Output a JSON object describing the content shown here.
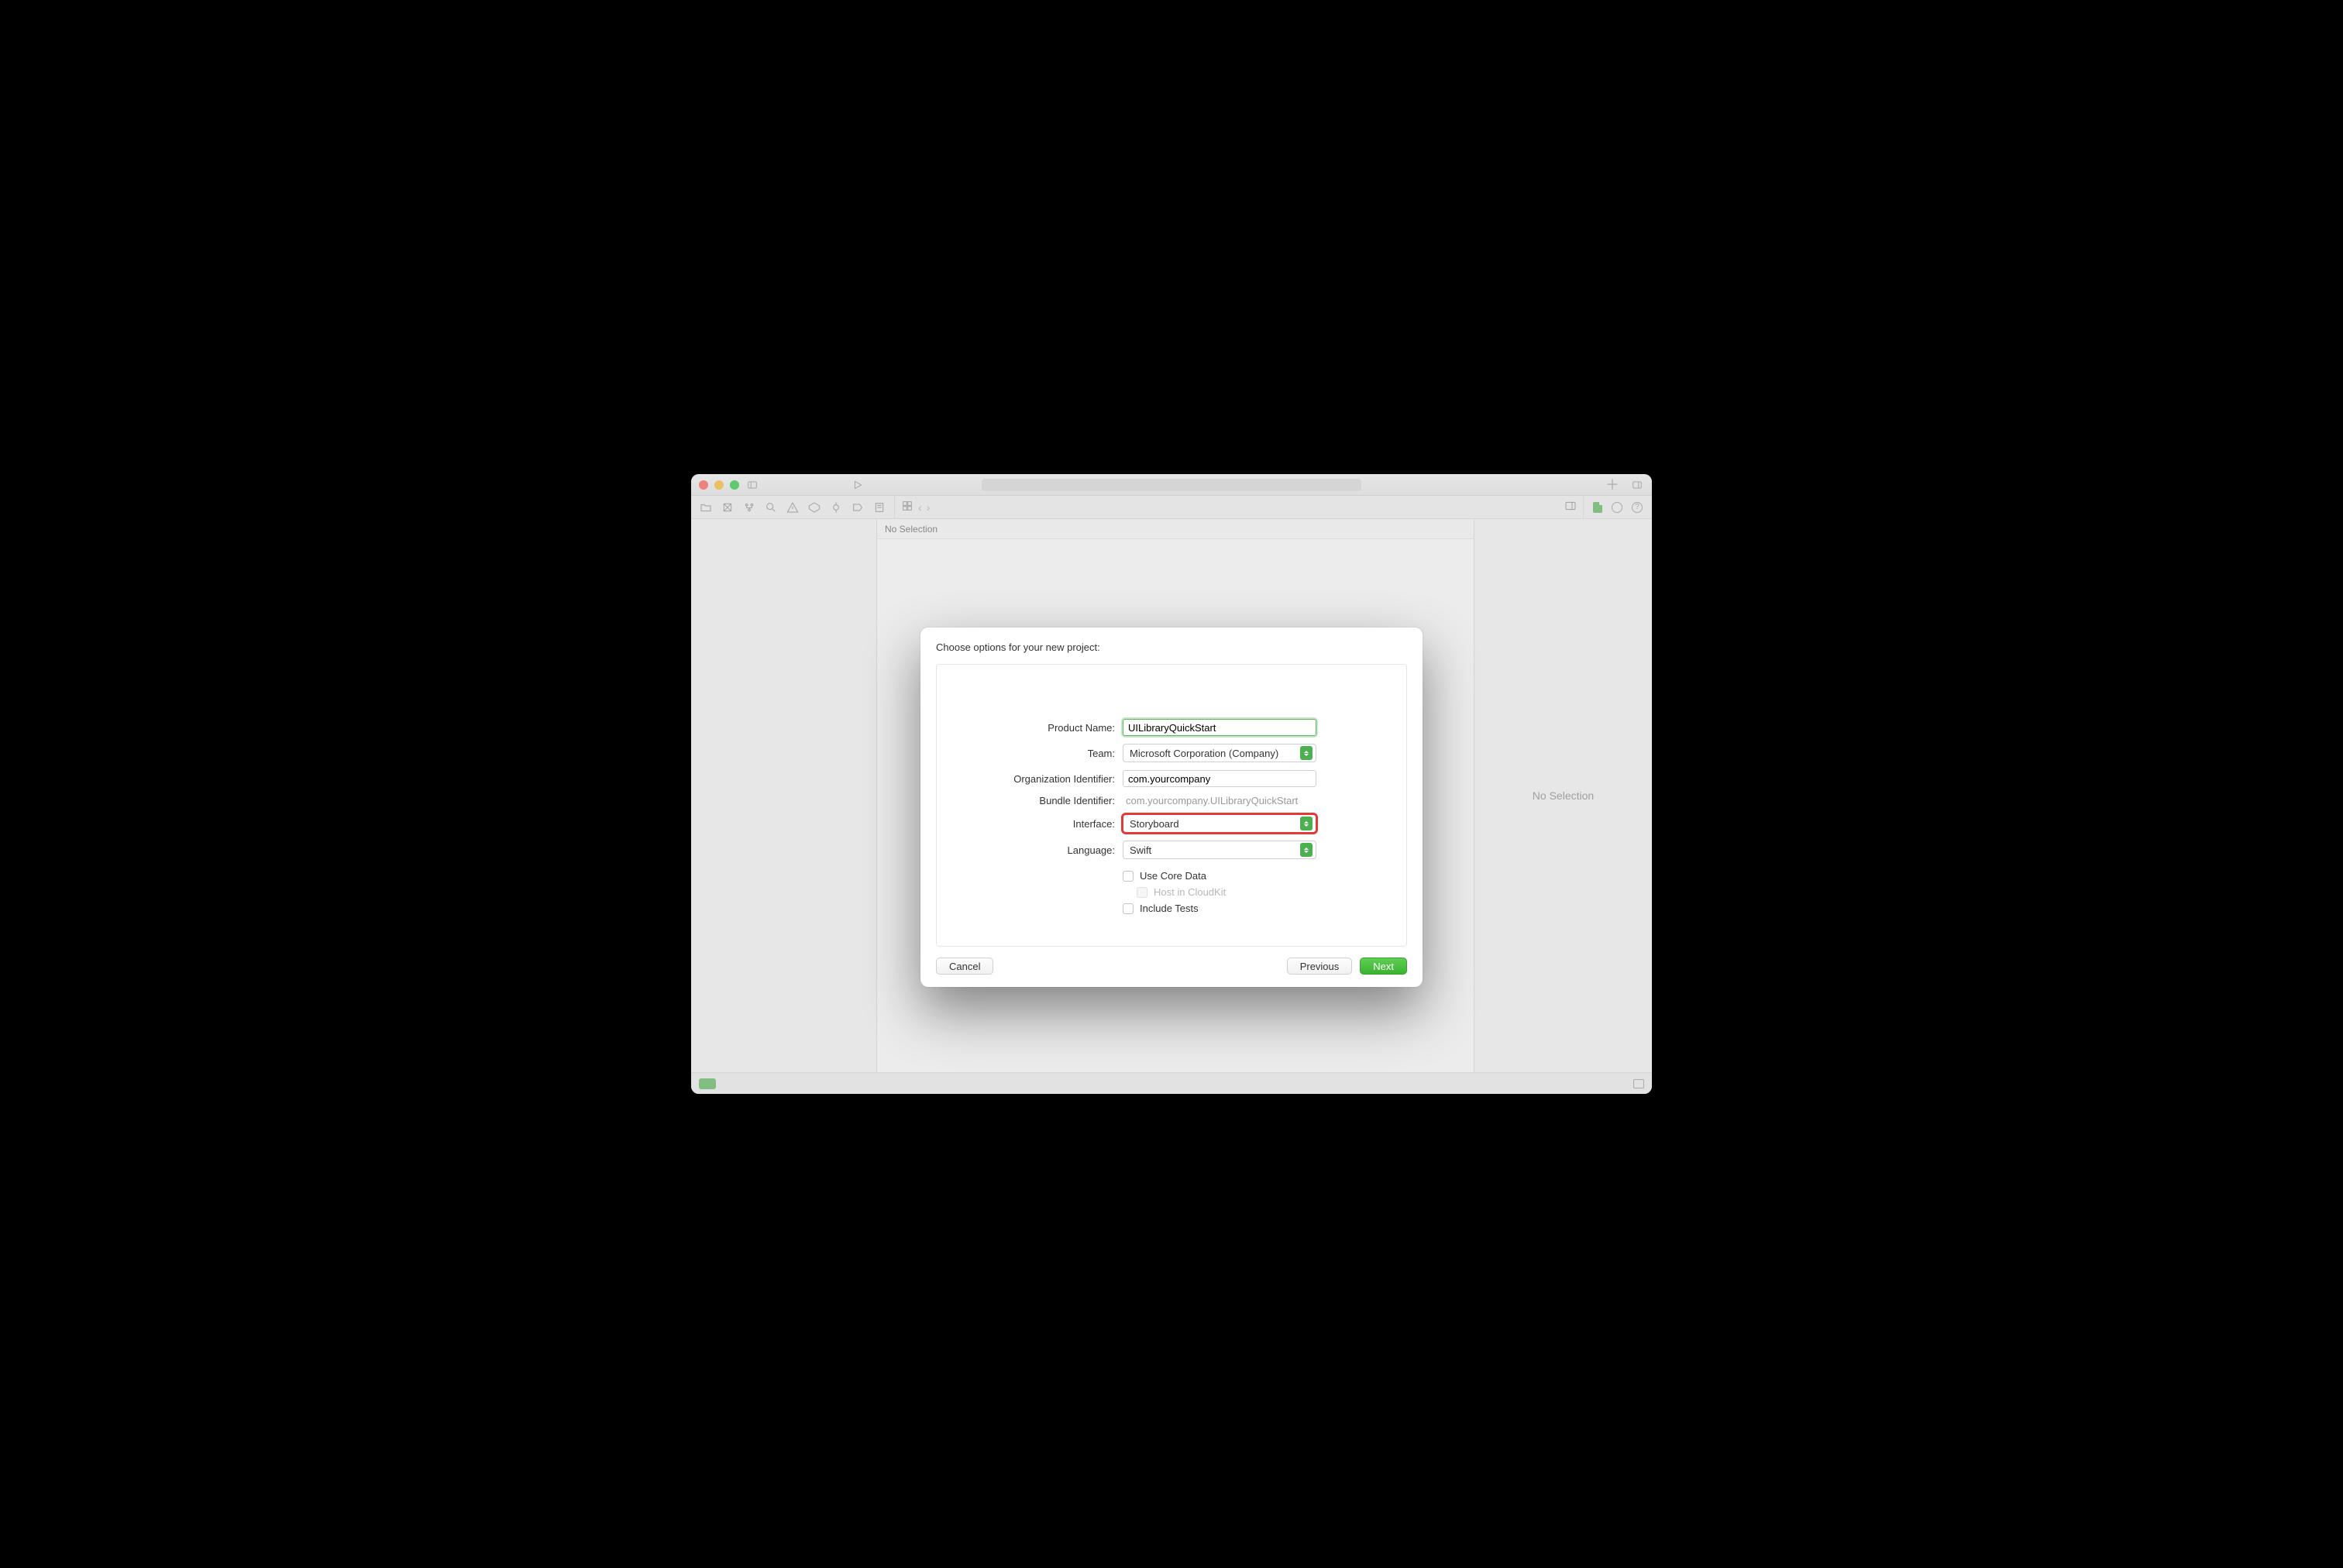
{
  "center_header": "No Selection",
  "right_pane_text": "No Selection",
  "sheet": {
    "title": "Choose options for your new project:",
    "labels": {
      "product_name": "Product Name:",
      "team": "Team:",
      "org_id": "Organization Identifier:",
      "bundle_id": "Bundle Identifier:",
      "interface": "Interface:",
      "language": "Language:"
    },
    "values": {
      "product_name": "UILibraryQuickStart",
      "team": "Microsoft Corporation (Company)",
      "org_id": "com.yourcompany",
      "bundle_id": "com.yourcompany.UILibraryQuickStart",
      "interface": "Storyboard",
      "language": "Swift"
    },
    "checks": {
      "core_data": "Use Core Data",
      "cloudkit": "Host in CloudKit",
      "tests": "Include Tests"
    },
    "buttons": {
      "cancel": "Cancel",
      "previous": "Previous",
      "next": "Next"
    }
  }
}
